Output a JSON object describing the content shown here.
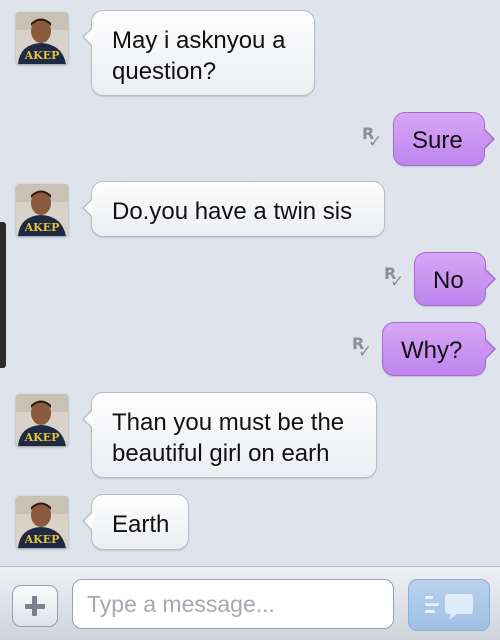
{
  "conversation": {
    "messages": [
      {
        "direction": "incoming",
        "text": "May i asknyou a\nquestion?"
      },
      {
        "direction": "outgoing",
        "text": "Sure"
      },
      {
        "direction": "incoming",
        "text": "Do.you have a twin sis"
      },
      {
        "direction": "outgoing",
        "text": "No"
      },
      {
        "direction": "outgoing",
        "text": "Why?"
      },
      {
        "direction": "incoming",
        "text": "Than you must be the\nbeautiful girl on earh"
      },
      {
        "direction": "incoming",
        "text": "Earth"
      }
    ],
    "avatar_icon": "contact-photo",
    "receipt_icon": "read-receipt-icon",
    "colors": {
      "outgoing_bubble": "#c994f1",
      "incoming_bubble": "#f7f8fa",
      "background": "#dfe3ec"
    }
  },
  "composer": {
    "placeholder": "Type a message...",
    "value": "",
    "add_icon": "plus-icon",
    "send_icon": "send-bubble-icon",
    "send_color": "#a9c8ea"
  }
}
